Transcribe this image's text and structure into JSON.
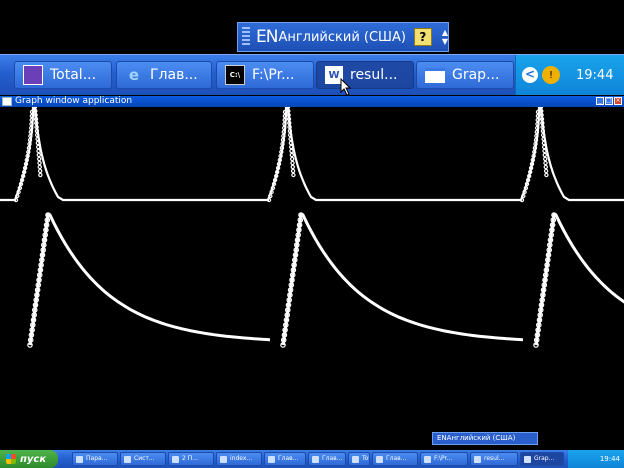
{
  "language_bar_top": {
    "code": "EN",
    "name": "Английский (США)",
    "help": "?"
  },
  "taskbar_zoom": {
    "buttons": [
      {
        "label": "Total...",
        "icon": "floppy-disk-icon"
      },
      {
        "label": "Глав...",
        "icon": "internet-explorer-icon"
      },
      {
        "label": "F:\\Pr...",
        "icon": "command-prompt-icon",
        "icon_text": "C:\\"
      },
      {
        "label": "resul...",
        "icon": "word-document-icon",
        "icon_text": "W"
      },
      {
        "label": "Grap...",
        "icon": "window-icon"
      }
    ],
    "clock": "19:44",
    "tray_chevron": "<"
  },
  "window": {
    "title": "Graph window application",
    "controls": [
      "_",
      "□",
      "×"
    ]
  },
  "language_bar_bottom": {
    "text": "ENАнглийский (США)"
  },
  "taskbar": {
    "start_label": "пуск",
    "items": [
      {
        "label": "Пара..."
      },
      {
        "label": "Сист..."
      },
      {
        "label": "2 П..."
      },
      {
        "label": "index..."
      },
      {
        "label": "Глав..."
      },
      {
        "label": "Глав..."
      },
      {
        "label": "Total..."
      },
      {
        "label": "Глав..."
      },
      {
        "label": "F:\\Pr..."
      },
      {
        "label": "resul..."
      },
      {
        "label": "Grap..."
      }
    ],
    "clock": "19:44"
  },
  "colors": {
    "xp_blue": "#245fcf",
    "tray_blue": "#0f84d8",
    "background": "#000000",
    "curve": "#ffffff"
  }
}
